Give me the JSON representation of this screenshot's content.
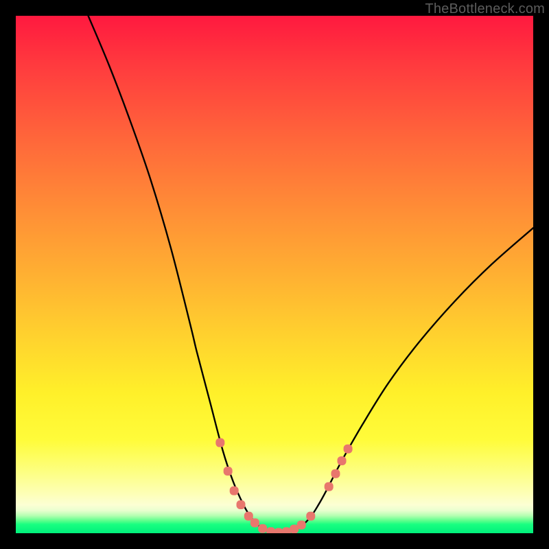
{
  "watermark": "TheBottleneck.com",
  "chart_data": {
    "type": "line",
    "title": "",
    "xlabel": "",
    "ylabel": "",
    "xlim": [
      0,
      100
    ],
    "ylim": [
      0,
      100
    ],
    "grid": false,
    "series": [
      {
        "name": "bottleneck-curve",
        "color": "#000000",
        "x": [
          14,
          18,
          22,
          26,
          30,
          33.8,
          35,
          37.5,
          40,
          42,
          44,
          45.5,
          47,
          49,
          51,
          53,
          55,
          57,
          58.5,
          60,
          63,
          67,
          72,
          78,
          85,
          92,
          100
        ],
        "y": [
          100,
          90.5,
          80,
          68.5,
          55,
          40,
          35,
          25.5,
          16,
          10,
          5.5,
          3,
          1.4,
          0.3,
          0.1,
          0.4,
          1.2,
          3.2,
          5.5,
          8.2,
          14,
          21,
          29,
          37,
          45,
          52,
          59
        ]
      }
    ],
    "markers": [
      {
        "name": "highlight-dots",
        "color": "#e8776d",
        "shape": "rounded",
        "points": [
          {
            "x": 39.5,
            "y": 17.5
          },
          {
            "x": 41.0,
            "y": 12.0
          },
          {
            "x": 42.2,
            "y": 8.2
          },
          {
            "x": 43.5,
            "y": 5.5
          },
          {
            "x": 45.0,
            "y": 3.3
          },
          {
            "x": 46.2,
            "y": 2.0
          },
          {
            "x": 47.7,
            "y": 0.9
          },
          {
            "x": 49.3,
            "y": 0.3
          },
          {
            "x": 50.8,
            "y": 0.15
          },
          {
            "x": 52.3,
            "y": 0.3
          },
          {
            "x": 53.8,
            "y": 0.8
          },
          {
            "x": 55.2,
            "y": 1.6
          },
          {
            "x": 57.0,
            "y": 3.3
          },
          {
            "x": 60.5,
            "y": 9.0
          },
          {
            "x": 61.8,
            "y": 11.5
          },
          {
            "x": 63.0,
            "y": 14.0
          },
          {
            "x": 64.2,
            "y": 16.3
          }
        ]
      }
    ]
  }
}
